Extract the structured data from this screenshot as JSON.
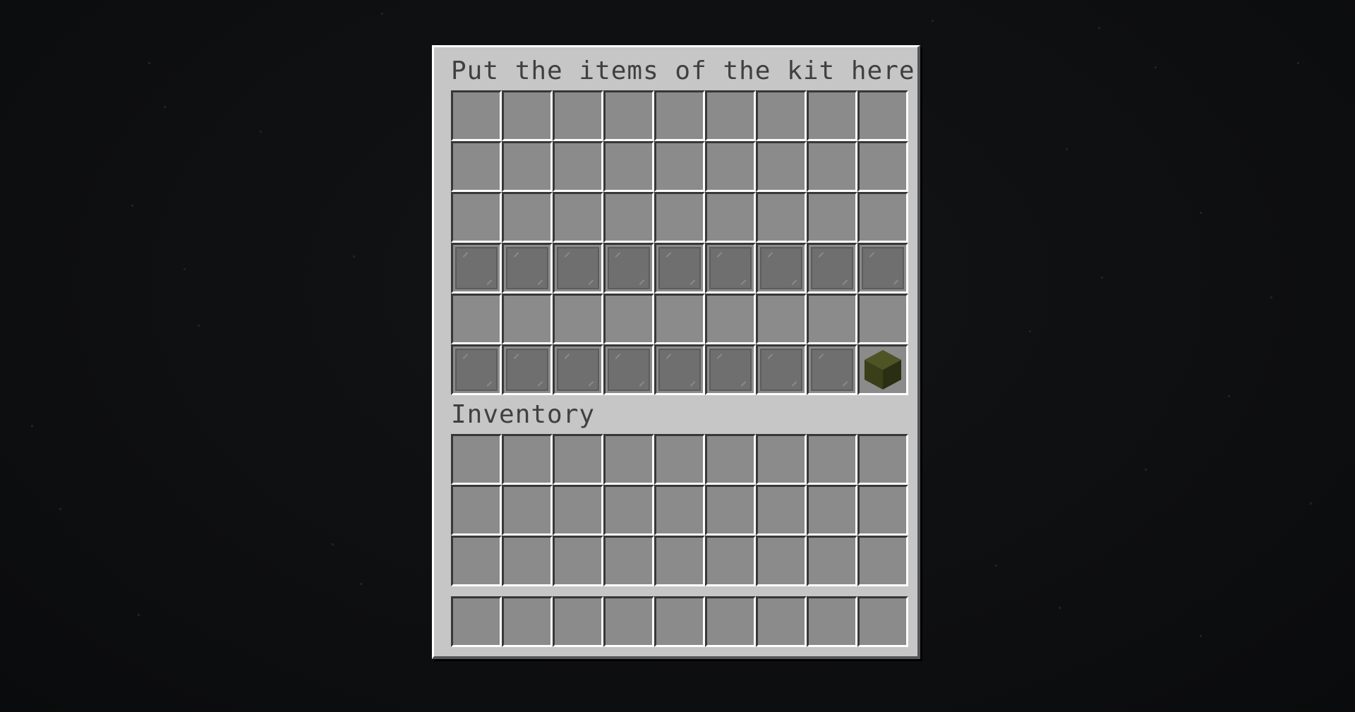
{
  "container": {
    "title": "Put the items of the kit here",
    "rows": [
      [
        "empty",
        "empty",
        "empty",
        "empty",
        "empty",
        "empty",
        "empty",
        "empty",
        "empty"
      ],
      [
        "empty",
        "empty",
        "empty",
        "empty",
        "empty",
        "empty",
        "empty",
        "empty",
        "empty"
      ],
      [
        "empty",
        "empty",
        "empty",
        "empty",
        "empty",
        "empty",
        "empty",
        "empty",
        "empty"
      ],
      [
        "glass-pane",
        "glass-pane",
        "glass-pane",
        "glass-pane",
        "glass-pane",
        "glass-pane",
        "glass-pane",
        "glass-pane",
        "glass-pane"
      ],
      [
        "empty",
        "empty",
        "empty",
        "empty",
        "empty",
        "empty",
        "empty",
        "empty",
        "empty"
      ],
      [
        "glass-pane",
        "glass-pane",
        "glass-pane",
        "glass-pane",
        "glass-pane",
        "glass-pane",
        "glass-pane",
        "glass-pane",
        "cube-block"
      ]
    ]
  },
  "inventory": {
    "title": "Inventory",
    "rows": [
      [
        "empty",
        "empty",
        "empty",
        "empty",
        "empty",
        "empty",
        "empty",
        "empty",
        "empty"
      ],
      [
        "empty",
        "empty",
        "empty",
        "empty",
        "empty",
        "empty",
        "empty",
        "empty",
        "empty"
      ],
      [
        "empty",
        "empty",
        "empty",
        "empty",
        "empty",
        "empty",
        "empty",
        "empty",
        "empty"
      ]
    ]
  },
  "hotbar": {
    "slots": [
      "empty",
      "empty",
      "empty",
      "empty",
      "empty",
      "empty",
      "empty",
      "empty",
      "empty"
    ]
  },
  "colors": {
    "panel": "#c6c6c6",
    "slot": "#8b8b8b",
    "title_text": "#404040",
    "block_top": "#4e5424",
    "block_left": "#3a3f1a",
    "block_right": "#2a2e12"
  }
}
